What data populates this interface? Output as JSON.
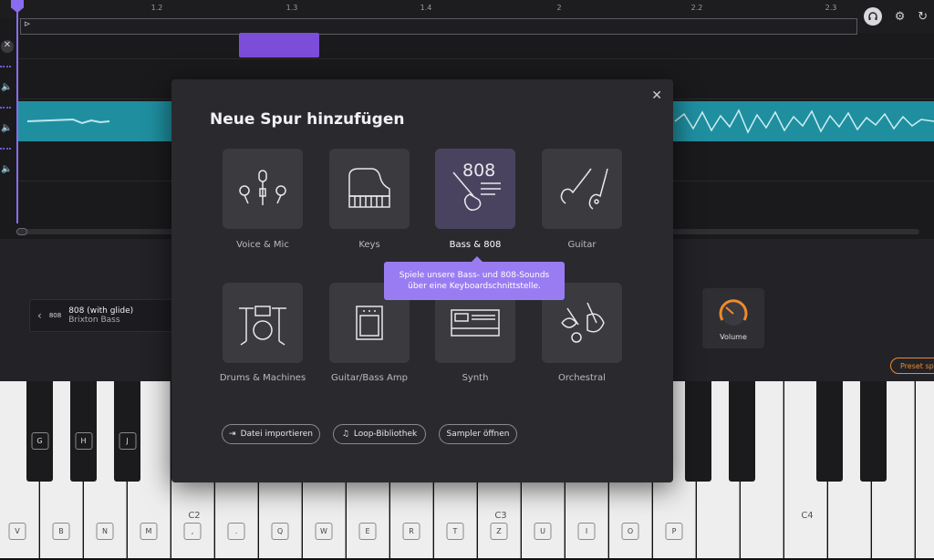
{
  "timeline": {
    "ticks": [
      "1.2",
      "1.3",
      "1.4",
      "2",
      "2.2",
      "2.3"
    ]
  },
  "modal": {
    "title": "Neue Spur hinzufügen",
    "close_icon": "close-icon",
    "tiles": [
      {
        "label": "Voice & Mic",
        "icon": "microphone-icon"
      },
      {
        "label": "Keys",
        "icon": "piano-icon"
      },
      {
        "label": "Bass & 808",
        "icon": "bass-guitar-icon",
        "badge": "808"
      },
      {
        "label": "Guitar",
        "icon": "guitar-icon"
      },
      {
        "label": "Drums & Machines",
        "icon": "drums-icon"
      },
      {
        "label": "Guitar/Bass Amp",
        "icon": "amp-icon"
      },
      {
        "label": "Synth",
        "icon": "synth-icon"
      },
      {
        "label": "Orchestral",
        "icon": "violin-icon"
      }
    ],
    "tooltip": "Spiele unsere Bass- und 808-Sounds über eine Keyboardschnittstelle.",
    "buttons": {
      "import": "Datei importieren",
      "loops": "Loop-Bibliothek",
      "sampler": "Sampler öffnen"
    }
  },
  "instrument": {
    "tag": "808",
    "preset_name": "808 (with glide)",
    "preset_sub": "Brixton Bass",
    "knob_label": "Volume",
    "preset_button": "Preset sp"
  },
  "keyboard": {
    "white_keys": [
      "V",
      "B",
      "N",
      "M",
      ",",
      ".",
      "Q",
      "W",
      "E",
      "R",
      "T",
      "Z",
      "U",
      "I",
      "O",
      "P"
    ],
    "black_keys": [
      "G",
      "H",
      "J"
    ],
    "octaves": [
      "C2",
      "C3",
      "C4"
    ]
  },
  "colors": {
    "accent": "#8a6cf0",
    "teal": "#1f8fa0",
    "orange": "#f08a2a"
  }
}
